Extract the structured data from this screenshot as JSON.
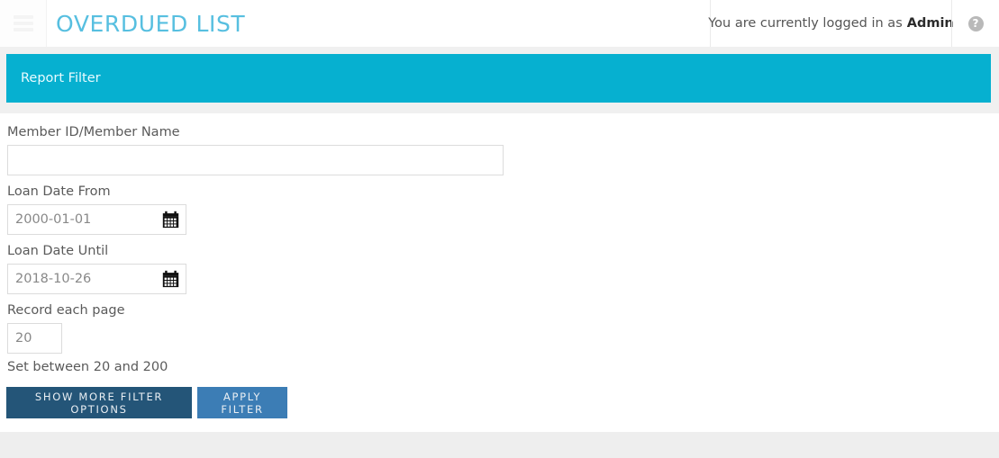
{
  "navbar": {
    "menu_icon": "hamburger-icon",
    "title": "OVERDUED LIST",
    "user_prefix": "You are currently logged in as",
    "user_name": "Admin",
    "help_icon": "question-mark-icon",
    "help_glyph": "?"
  },
  "panel": {
    "heading": "Report Filter"
  },
  "form": {
    "member": {
      "label": "Member ID/Member Name",
      "value": "",
      "placeholder": ""
    },
    "loan_date_from": {
      "label": "Loan Date From",
      "value": "2000-01-01",
      "placeholder": "2000-01-01",
      "icon": "calendar-icon"
    },
    "loan_date_until": {
      "label": "Loan Date Until",
      "value": "2018-10-26",
      "placeholder": "2018-10-26",
      "icon": "calendar-icon"
    },
    "record_each_page": {
      "label": "Record each page",
      "value": "20",
      "placeholder": "20",
      "helper": "Set between 20 and 200"
    }
  },
  "buttons": {
    "show_more": "SHOW MORE FILTER OPTIONS",
    "apply_filter": "APPLY FILTER"
  },
  "colors": {
    "brand_teal": "#06b0d0",
    "title_blue": "#57bfe0",
    "btn_dark_blue": "#245578",
    "btn_light_blue": "#3c7db5",
    "page_bg": "#f0f0f0"
  }
}
